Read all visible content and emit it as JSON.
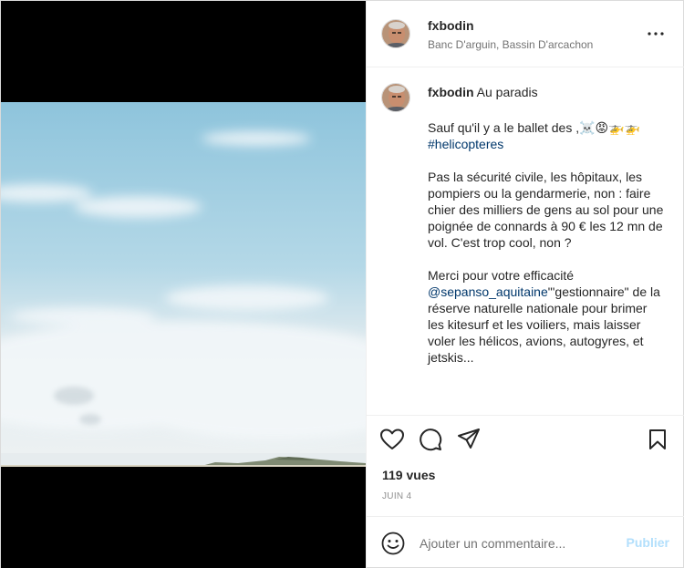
{
  "post": {
    "username": "fxbodin",
    "location": "Banc D'arguin, Bassin D'arcachon",
    "caption": {
      "username": "fxbodin",
      "title": "Au paradis",
      "line1": "Sauf qu'il y a le ballet des ,",
      "emojis": "☠️😡🚁🚁",
      "hashtag": "#helicopteres",
      "paragraph2": "Pas la sécurité civile, les hôpitaux, les pompiers ou la gendarmerie, non : faire chier des milliers de gens au sol pour une poignée de connards à 90 € les 12 mn de vol. C'est trop cool, non ?",
      "paragraph3_start": "Merci pour votre efficacité",
      "mention": "@sepanso_aquitaine",
      "paragraph3_rest": "\"'gestionnaire\" de la réserve naturelle nationale pour brimer les kitesurf et les voiliers, mais laisser voler les hélicos, avions, autogyres, et jetskis..."
    },
    "views": "119 vues",
    "date": "JUIN 4"
  },
  "comment_box": {
    "placeholder": "Ajouter un commentaire...",
    "publish_label": "Publier"
  },
  "icons": {
    "more": "more-horizontal-icon",
    "like": "heart-icon",
    "comment": "comment-icon",
    "share": "paper-plane-icon",
    "save": "bookmark-icon",
    "emoji": "smiley-icon"
  },
  "colors": {
    "link": "#00376b",
    "publish_disabled": "#b2dffc",
    "secondary_text": "#737373"
  }
}
